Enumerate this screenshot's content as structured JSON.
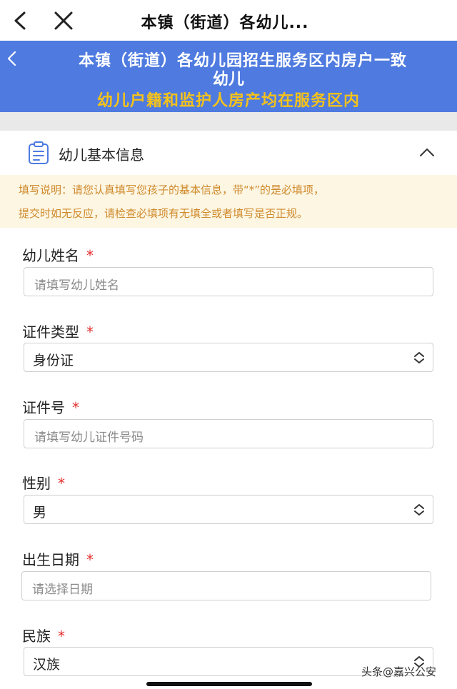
{
  "topbar": {
    "title": "本镇（街道）各幼儿..."
  },
  "header": {
    "line1": "本镇（街道）各幼儿园招生服务区内房户一致",
    "line2": "幼儿",
    "line3": "幼儿户籍和监护人房产均在服务区内"
  },
  "section": {
    "title": "幼儿基本信息"
  },
  "notice": {
    "line1": "填写说明：请您认真填写您孩子的基本信息，带“*”的是必填项，",
    "line2": "提交时如无反应，请检查必填项有无填全或者填写是否正规。"
  },
  "form": {
    "required_mark": "*",
    "name": {
      "label": "幼儿姓名",
      "placeholder": "请填写幼儿姓名"
    },
    "id_type": {
      "label": "证件类型",
      "value": "身份证"
    },
    "id_number": {
      "label": "证件号",
      "placeholder": "请填写幼儿证件号码"
    },
    "gender": {
      "label": "性别",
      "value": "男"
    },
    "birth_date": {
      "label": "出生日期",
      "placeholder": "请选择日期"
    },
    "ethnicity": {
      "label": "民族",
      "value": "汉族"
    }
  },
  "watermark": "头条@嘉兴公安",
  "colors": {
    "header_bg": "#4f7be0",
    "header_highlight": "#f4c21b",
    "notice_text": "#d08a2c",
    "required": "#e23030"
  }
}
